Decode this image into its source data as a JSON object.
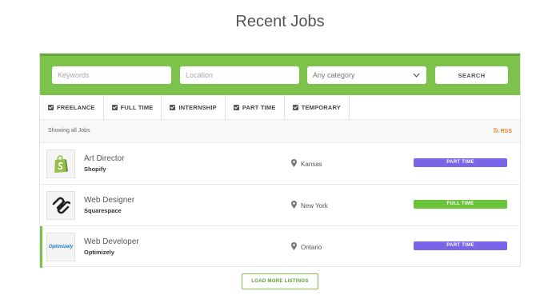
{
  "page": {
    "title": "Recent Jobs"
  },
  "search": {
    "keywords_placeholder": "Keywords",
    "location_placeholder": "Location",
    "category_value": "Any category",
    "search_label": "SEARCH",
    "accent_color": "#7dc24b"
  },
  "filters": [
    {
      "label": "FREELANCE",
      "checked": true
    },
    {
      "label": "FULL TIME",
      "checked": true
    },
    {
      "label": "INTERNSHIP",
      "checked": true
    },
    {
      "label": "PART TIME",
      "checked": true
    },
    {
      "label": "TEMPORARY",
      "checked": true
    }
  ],
  "results": {
    "showing_text": "Showing all Jobs",
    "rss_label": "RSS"
  },
  "jobs": [
    {
      "title": "Art Director",
      "company": "Shopify",
      "location": "Kansas",
      "type": "PART TIME",
      "type_color": "#7a64e8",
      "logo_icon": "shopify-logo"
    },
    {
      "title": "Web Designer",
      "company": "Squarespace",
      "location": "New York",
      "type": "FULL TIME",
      "type_color": "#6bc43a",
      "logo_icon": "squarespace-logo"
    },
    {
      "title": "Web Developer",
      "company": "Optimizely",
      "location": "Ontario",
      "type": "PART TIME",
      "type_color": "#7a64e8",
      "logo_icon": "optimizely-logo",
      "logo_text": "Optimizely"
    }
  ],
  "load_more_label": "LOAD MORE LISTINGS"
}
